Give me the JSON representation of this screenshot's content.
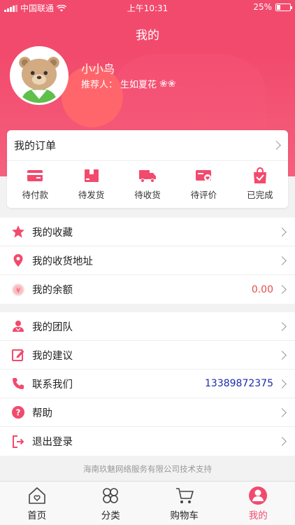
{
  "status_bar": {
    "carrier": "中国联通",
    "time": "上午10:31",
    "battery": "25%",
    "battery_level": 0.25
  },
  "header": {
    "title": "我的",
    "user_name": "小小鸟",
    "referrer_label": "推荐人：",
    "referrer_name": "生如夏花",
    "flowers": "❀❀"
  },
  "orders": {
    "title": "我的订单",
    "tabs": [
      {
        "label": "待付款",
        "icon": "wallet-icon"
      },
      {
        "label": "待发货",
        "icon": "box-icon"
      },
      {
        "label": "待收货",
        "icon": "truck-icon"
      },
      {
        "label": "待评价",
        "icon": "review-icon"
      },
      {
        "label": "已完成",
        "icon": "completed-bag-icon"
      }
    ]
  },
  "menu_group1": [
    {
      "label": "我的收藏",
      "icon": "star-icon"
    },
    {
      "label": "我的收货地址",
      "icon": "location-pin-icon"
    },
    {
      "label": "我的余额",
      "icon": "yuan-coin-icon",
      "value": "0.00"
    }
  ],
  "menu_group2": [
    {
      "label": "我的团队",
      "icon": "team-icon"
    },
    {
      "label": "我的建议",
      "icon": "edit-icon"
    },
    {
      "label": "联系我们",
      "icon": "phone-icon",
      "value": "13389872375"
    },
    {
      "label": "帮助",
      "icon": "help-icon"
    },
    {
      "label": "退出登录",
      "icon": "logout-icon"
    }
  ],
  "footer": "海南玖魅网络服务有限公司技术支持",
  "tabbar": [
    {
      "label": "首页",
      "icon": "home-icon",
      "active": false
    },
    {
      "label": "分类",
      "icon": "category-icon",
      "active": false
    },
    {
      "label": "购物车",
      "icon": "cart-icon",
      "active": false
    },
    {
      "label": "我的",
      "icon": "profile-icon",
      "active": true
    }
  ],
  "colors": {
    "brand": "#f24a6d",
    "balance": "#e94b4b",
    "phone": "#1a2aa8"
  }
}
